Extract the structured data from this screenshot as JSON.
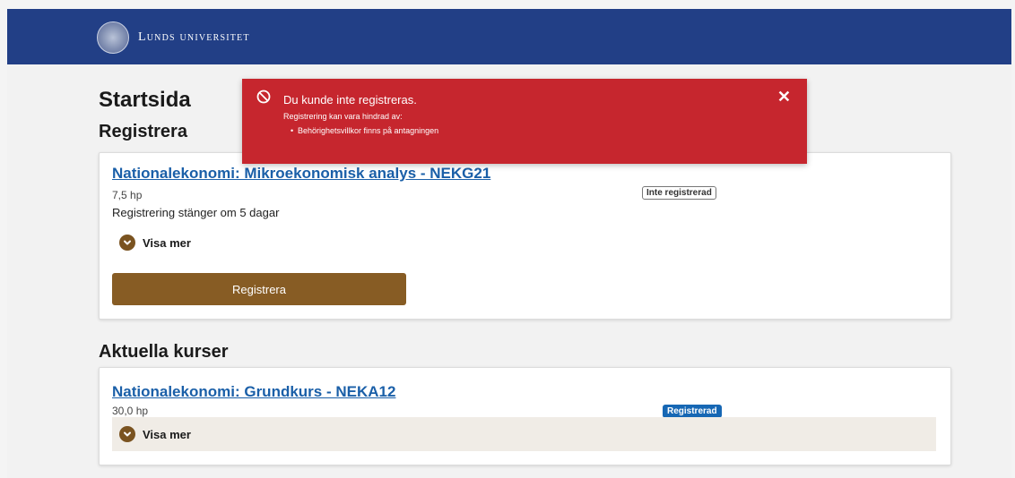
{
  "header": {
    "logo_text": "Lunds universitet"
  },
  "page": {
    "title": "Startsida"
  },
  "registrera_section": {
    "heading": "Registrera",
    "course": {
      "title": "Nationalekonomi: Mikroekonomisk analys - NEKG21",
      "credits": "7,5 hp",
      "note": "Registrering stänger om 5 dagar",
      "status": "Inte registrerad",
      "show_more": "Visa mer",
      "button": "Registrera"
    }
  },
  "aktuella_section": {
    "heading": "Aktuella kurser",
    "course": {
      "title": "Nationalekonomi: Grundkurs - NEKA12",
      "credits": "30,0 hp",
      "status": "Registrerad",
      "show_more": "Visa mer"
    }
  },
  "alert": {
    "title": "Du kunde inte registreras.",
    "subtitle": "Registrering kan vara hindrad av:",
    "items": [
      "Behörighetsvillkor finns på antagningen"
    ],
    "close_icon": "close-icon",
    "icon": "prohibited-icon"
  },
  "colors": {
    "header": "#223f86",
    "alert": "#c6262e",
    "brand_button": "#875c24",
    "link": "#1a5fa8",
    "badge_blue": "#1667b4"
  }
}
